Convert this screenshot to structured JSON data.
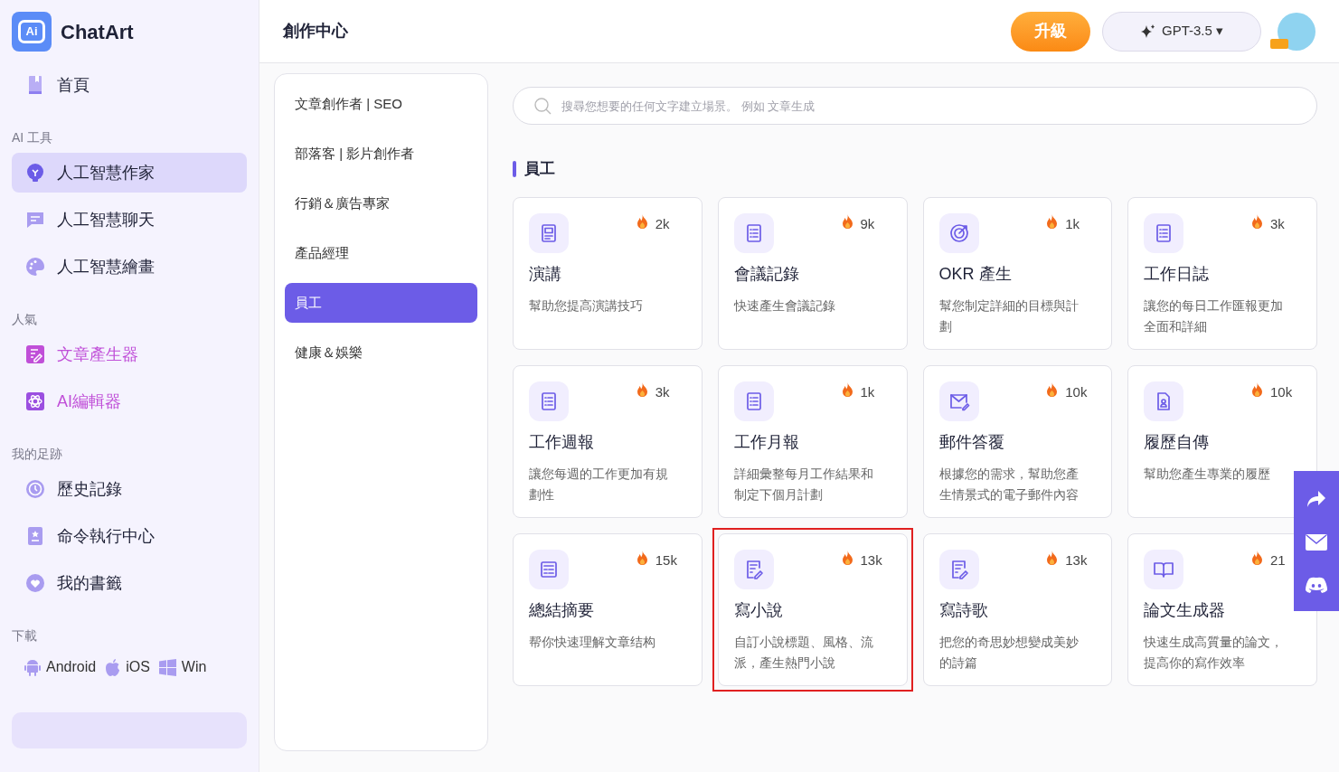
{
  "brand": {
    "logo_text": "Ai",
    "name": "ChatArt"
  },
  "sidebar": {
    "sections": [
      {
        "items": [
          {
            "label": "首頁",
            "selected": false,
            "accent": false
          }
        ]
      },
      {
        "heading": "AI 工具",
        "items": [
          {
            "label": "人工智慧作家",
            "selected": true,
            "accent": false
          },
          {
            "label": "人工智慧聊天",
            "selected": false,
            "accent": false
          },
          {
            "label": "人工智慧繪畫",
            "selected": false,
            "accent": false
          }
        ]
      },
      {
        "heading": "人氣",
        "items": [
          {
            "label": "文章產生器",
            "selected": false,
            "accent": true
          },
          {
            "label": "AI編輯器",
            "selected": false,
            "accent": true
          }
        ]
      },
      {
        "heading": "我的足跡",
        "items": [
          {
            "label": "歷史記錄",
            "selected": false,
            "accent": false
          },
          {
            "label": "命令執行中心",
            "selected": false,
            "accent": false
          },
          {
            "label": "我的書籤",
            "selected": false,
            "accent": false
          }
        ]
      }
    ],
    "download": {
      "heading": "下載",
      "platforms": [
        {
          "label": "Android"
        },
        {
          "label": "iOS"
        },
        {
          "label": "Win"
        }
      ]
    }
  },
  "header": {
    "title": "創作中心",
    "upgrade_button": "升級",
    "model_selector": "GPT-3.5 ▾"
  },
  "categories": [
    {
      "label": "文章創作者 | SEO",
      "selected": false
    },
    {
      "label": "部落客 | 影片創作者",
      "selected": false
    },
    {
      "label": "行銷＆廣告專家",
      "selected": false
    },
    {
      "label": "產品經理",
      "selected": false
    },
    {
      "label": "員工",
      "selected": true
    },
    {
      "label": "健康＆娛樂",
      "selected": false
    }
  ],
  "search": {
    "placeholder": "搜尋您想要的任何文字建立場景。 例如 文章生成"
  },
  "section_title": "員工",
  "cards": [
    {
      "title": "演講",
      "description": "幫助您提高演講技巧",
      "count": "2k",
      "highlighted": false
    },
    {
      "title": "會議記錄",
      "description": "快速產生會議記錄",
      "count": "9k",
      "highlighted": false
    },
    {
      "title": "OKR 產生",
      "description": "幫您制定詳細的目標與計劃",
      "count": "1k",
      "highlighted": false
    },
    {
      "title": "工作日誌",
      "description": "讓您的每日工作匯報更加全面和詳細",
      "count": "3k",
      "highlighted": false
    },
    {
      "title": "工作週報",
      "description": "讓您每週的工作更加有規劃性",
      "count": "3k",
      "highlighted": false
    },
    {
      "title": "工作月報",
      "description": "詳細彙整每月工作結果和制定下個月計劃",
      "count": "1k",
      "highlighted": false
    },
    {
      "title": "郵件答覆",
      "description": "根據您的需求，幫助您產生情景式的電子郵件內容",
      "count": "10k",
      "highlighted": false
    },
    {
      "title": "履歷自傳",
      "description": "幫助您產生專業的履歷",
      "count": "10k",
      "highlighted": false
    },
    {
      "title": "總結摘要",
      "description": "帮你快速理解文章结构",
      "count": "15k",
      "highlighted": false
    },
    {
      "title": "寫小說",
      "description": "自訂小說標題、風格、流派，產生熱門小說",
      "count": "13k",
      "highlighted": true
    },
    {
      "title": "寫詩歌",
      "description": "把您的奇思妙想變成美妙的詩篇",
      "count": "13k",
      "highlighted": false
    },
    {
      "title": "論文生成器",
      "description": "快速生成高質量的論文，提高你的寫作效率",
      "count": "21",
      "highlighted": false
    }
  ]
}
